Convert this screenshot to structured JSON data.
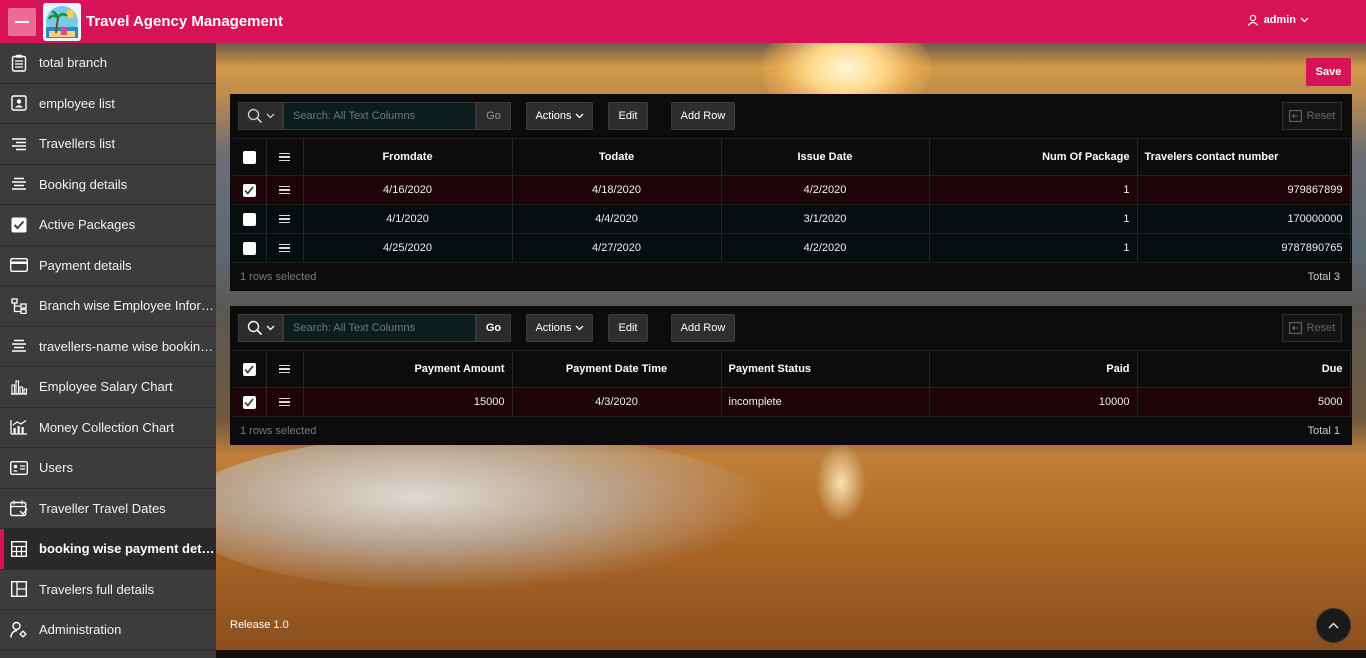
{
  "header": {
    "app_title": "Travel Agency Management",
    "user": "admin",
    "brand_color": "#d81257"
  },
  "sidebar": {
    "items": [
      {
        "label": "total branch",
        "icon": "clipboard-icon"
      },
      {
        "label": "employee list",
        "icon": "contact-card-icon"
      },
      {
        "label": "Travellers list",
        "icon": "list-lines-icon"
      },
      {
        "label": "Booking details",
        "icon": "list-center-icon"
      },
      {
        "label": "Active Packages",
        "icon": "checkbox-icon"
      },
      {
        "label": "Payment details",
        "icon": "credit-card-icon"
      },
      {
        "label": "Branch wise Employee Informa...",
        "icon": "hierarchy-icon"
      },
      {
        "label": "travellers-name wise booking ...",
        "icon": "list-center-icon"
      },
      {
        "label": "Employee Salary Chart",
        "icon": "bar-chart-icon"
      },
      {
        "label": "Money Collection Chart",
        "icon": "line-bar-chart-icon"
      },
      {
        "label": "Users",
        "icon": "id-card-icon"
      },
      {
        "label": "Traveller Travel Dates",
        "icon": "calendar-icon"
      },
      {
        "label": "booking wise payment details",
        "icon": "table-grid-icon",
        "active": true
      },
      {
        "label": "Travelers full details",
        "icon": "panel-layout-icon"
      },
      {
        "label": "Administration",
        "icon": "user-gear-icon"
      }
    ]
  },
  "page": {
    "save_label": "Save",
    "release": "Release 1.0"
  },
  "grid1": {
    "search_placeholder": "Search: All Text Columns",
    "go_label": "Go",
    "actions_label": "Actions",
    "edit_label": "Edit",
    "add_row_label": "Add Row",
    "reset_label": "Reset",
    "columns": [
      "Fromdate",
      "Todate",
      "Issue Date",
      "Num Of Package",
      "Travelers contact number"
    ],
    "rows": [
      {
        "selected": true,
        "cells": [
          "4/16/2020",
          "4/18/2020",
          "4/2/2020",
          "1",
          "979867899"
        ]
      },
      {
        "selected": false,
        "cells": [
          "4/1/2020",
          "4/4/2020",
          "3/1/2020",
          "1",
          "170000000"
        ]
      },
      {
        "selected": false,
        "cells": [
          "4/25/2020",
          "4/27/2020",
          "4/2/2020",
          "1",
          "9787890765"
        ]
      }
    ],
    "selected_text": "1 rows selected",
    "total_text": "Total 3"
  },
  "grid2": {
    "search_placeholder": "Search: All Text Columns",
    "go_label": "Go",
    "actions_label": "Actions",
    "edit_label": "Edit",
    "add_row_label": "Add Row",
    "reset_label": "Reset",
    "columns": [
      "Payment Amount",
      "Payment Date Time",
      "Payment Status",
      "Paid",
      "Due"
    ],
    "rows": [
      {
        "selected": true,
        "cells": [
          "15000",
          "4/3/2020",
          "incomplete",
          "10000",
          "5000"
        ]
      }
    ],
    "selected_text": "1 rows selected",
    "total_text": "Total 1"
  }
}
